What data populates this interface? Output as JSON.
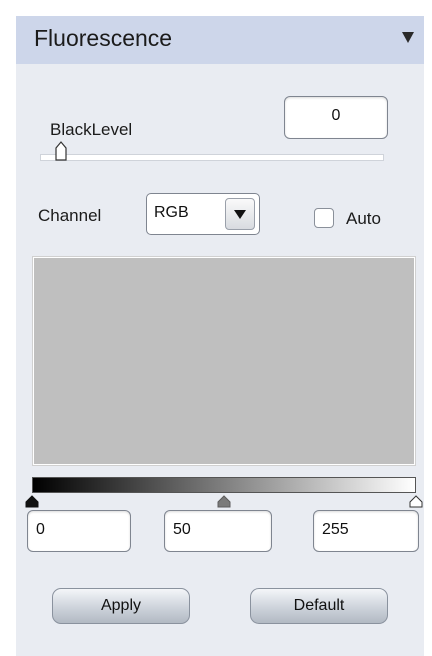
{
  "panel": {
    "title": "Fluorescence",
    "collapse_icon": "triangle-down-icon"
  },
  "black_level": {
    "label": "BlackLevel",
    "value": "0",
    "slider_fraction": 0.0
  },
  "channel": {
    "label": "Channel",
    "selected": "RGB",
    "dropdown_icon": "triangle-down-icon"
  },
  "auto": {
    "label": "Auto",
    "checked": false
  },
  "histogram": {
    "background_color": "#bfbfbf"
  },
  "levels": {
    "gradient_from": "#000000",
    "gradient_to": "#ffffff",
    "black_point": "0",
    "midtone": "50",
    "white_point": "255",
    "marker_fractions": {
      "black": 0.0,
      "mid": 0.5,
      "white": 1.0
    }
  },
  "buttons": {
    "apply": "Apply",
    "default": "Default"
  }
}
